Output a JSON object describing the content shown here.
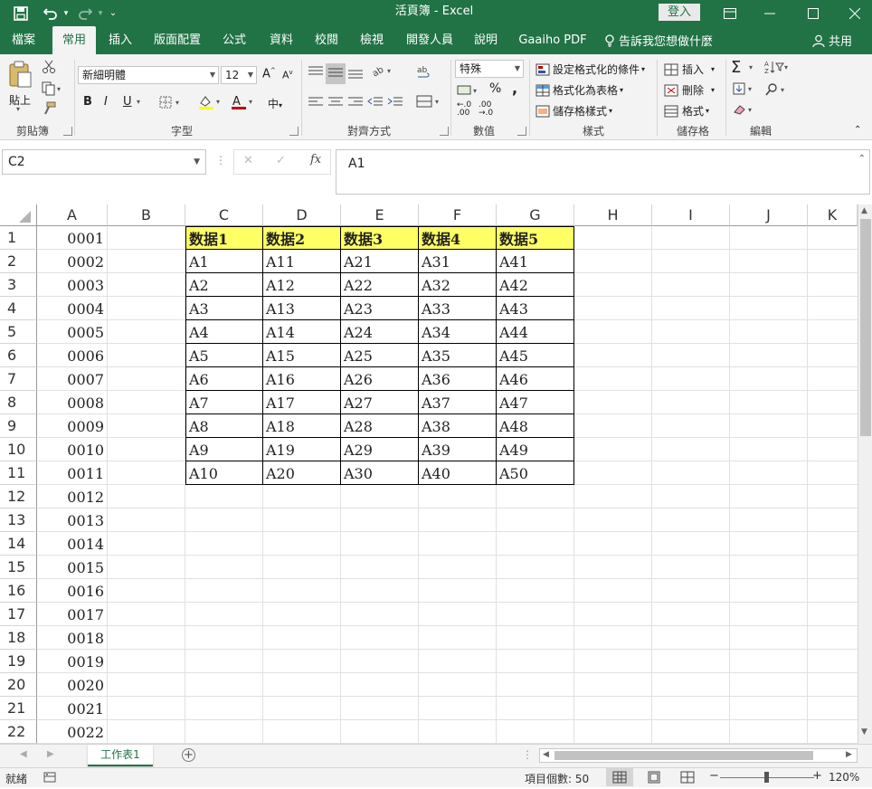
{
  "window": {
    "title": "活頁簿 - Excel",
    "login_label": "登入",
    "colors": {
      "brand": "#217346",
      "header_fill": "#ffff66",
      "tab_text": "#217346"
    }
  },
  "quick_access": {
    "icons": [
      "save-icon",
      "undo-icon",
      "redo-icon",
      "customize-icon"
    ]
  },
  "window_controls": {
    "icons": [
      "ribbon-display-icon",
      "minimize-icon",
      "restore-icon",
      "close-icon"
    ]
  },
  "tabs": [
    "檔案",
    "常用",
    "插入",
    "版面配置",
    "公式",
    "資料",
    "校閱",
    "檢視",
    "開發人員",
    "說明",
    "Gaaiho PDF"
  ],
  "active_tab": "常用",
  "tell_me": "告訴我您想做什麼",
  "share_label": "共用",
  "ribbon": {
    "clipboard": {
      "paste": "貼上",
      "label": "剪貼簿"
    },
    "font": {
      "name": "新細明體",
      "size": "12",
      "bold": "B",
      "italic": "I",
      "underline": "U",
      "label": "字型"
    },
    "alignment": {
      "label": "對齊方式"
    },
    "number": {
      "format": "特殊",
      "percent": "%",
      "comma": ",",
      "label": "數值"
    },
    "styles": {
      "conditional": "設定格式化的條件",
      "as_table": "格式化為表格",
      "cell_styles": "儲存格樣式",
      "label": "樣式"
    },
    "cells": {
      "insert": "插入",
      "delete": "刪除",
      "format": "格式",
      "label": "儲存格"
    },
    "editing": {
      "sum": "Σ",
      "label": "編輯"
    }
  },
  "formula_bar": {
    "name_box": "C2",
    "fx": "fx",
    "content": "A1"
  },
  "columns": [
    "A",
    "B",
    "C",
    "D",
    "E",
    "F",
    "G",
    "H",
    "I",
    "J",
    "K"
  ],
  "rows": [
    "1",
    "2",
    "3",
    "4",
    "5",
    "6",
    "7",
    "8",
    "9",
    "10",
    "11",
    "12",
    "13",
    "14",
    "15",
    "16",
    "17",
    "18",
    "19",
    "20",
    "21",
    "22"
  ],
  "col_a": [
    "0001",
    "0002",
    "0003",
    "0004",
    "0005",
    "0006",
    "0007",
    "0008",
    "0009",
    "0010",
    "0011",
    "0012",
    "0013",
    "0014",
    "0015",
    "0016",
    "0017",
    "0018",
    "0019",
    "0020",
    "0021",
    "0022"
  ],
  "table": {
    "headers": [
      "数据1",
      "数据2",
      "数据3",
      "数据4",
      "数据5"
    ],
    "rows": [
      [
        "A1",
        "A11",
        "A21",
        "A31",
        "A41"
      ],
      [
        "A2",
        "A12",
        "A22",
        "A32",
        "A42"
      ],
      [
        "A3",
        "A13",
        "A23",
        "A33",
        "A43"
      ],
      [
        "A4",
        "A14",
        "A24",
        "A34",
        "A44"
      ],
      [
        "A5",
        "A15",
        "A25",
        "A35",
        "A45"
      ],
      [
        "A6",
        "A16",
        "A26",
        "A36",
        "A46"
      ],
      [
        "A7",
        "A17",
        "A27",
        "A37",
        "A47"
      ],
      [
        "A8",
        "A18",
        "A28",
        "A38",
        "A48"
      ],
      [
        "A9",
        "A19",
        "A29",
        "A39",
        "A49"
      ],
      [
        "A10",
        "A20",
        "A30",
        "A40",
        "A50"
      ]
    ]
  },
  "sheet_tab": "工作表1",
  "status": {
    "ready": "就緒",
    "count": "項目個數: 50",
    "zoom": "120%"
  }
}
